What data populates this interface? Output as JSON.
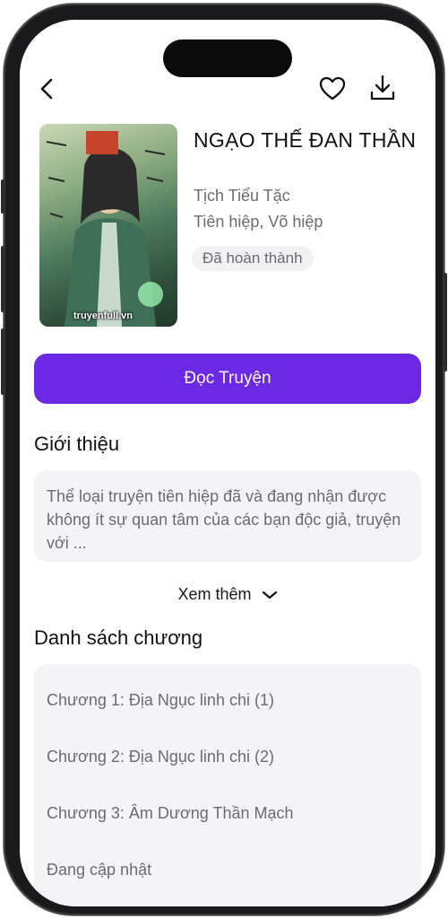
{
  "header": {
    "back_icon": "back-arrow-icon",
    "favorite_icon": "heart-icon",
    "download_icon": "download-icon"
  },
  "book": {
    "cover_watermark": "truyenfull.vn",
    "title": "NGẠO THẾ ĐAN THẦN",
    "author": "Tịch Tiểu Tặc",
    "genres": "Tiên hiệp, Võ hiệp",
    "status": "Đã hoàn thành"
  },
  "actions": {
    "read_label": "Đọc Truyện",
    "accent_color": "#6b29e6"
  },
  "intro": {
    "heading": "Giới thiệu",
    "text": "Thể loại truyện tiên hiệp đã và đang nhận được không ít sự quan tâm của các bạn độc giả, truyện với ...",
    "more_label": "Xem thêm"
  },
  "chapters": {
    "heading": "Danh sách chương",
    "items": [
      {
        "label": "Chương 1: Địa Ngục linh chi (1)"
      },
      {
        "label": "Chương 2: Địa Ngục linh chi (2)"
      },
      {
        "label": "Chương 3: Âm Dương Thần Mạch"
      },
      {
        "label": "Đang cập nhật"
      }
    ]
  }
}
